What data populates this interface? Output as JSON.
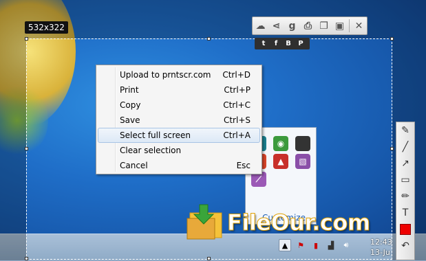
{
  "selection": {
    "size_label": "532x322"
  },
  "toolbar": {
    "buttons": [
      {
        "name": "upload-cloud-icon",
        "glyph": "☁"
      },
      {
        "name": "share-icon",
        "glyph": "⋖"
      },
      {
        "name": "google-icon",
        "glyph": "g"
      },
      {
        "name": "print-icon",
        "glyph": "⎙"
      },
      {
        "name": "copy-icon",
        "glyph": "❐"
      },
      {
        "name": "save-icon",
        "glyph": "▣"
      },
      {
        "name": "close-icon",
        "glyph": "✕"
      }
    ]
  },
  "social": [
    "t",
    "f",
    "B",
    "P"
  ],
  "context_menu": {
    "items": [
      {
        "label": "Upload to prntscr.com",
        "shortcut": "Ctrl+D"
      },
      {
        "label": "Print",
        "shortcut": "Ctrl+P"
      },
      {
        "label": "Copy",
        "shortcut": "Ctrl+C"
      },
      {
        "label": "Save",
        "shortcut": "Ctrl+S"
      },
      {
        "label": "Select full screen",
        "shortcut": "Ctrl+A"
      },
      {
        "label": "Clear selection",
        "shortcut": ""
      },
      {
        "label": "Cancel",
        "shortcut": "Esc"
      }
    ],
    "highlighted_index": 4
  },
  "side_tools": [
    {
      "name": "pen-icon",
      "glyph": "✎"
    },
    {
      "name": "line-icon",
      "glyph": "╱"
    },
    {
      "name": "arrow-icon",
      "glyph": "↗"
    },
    {
      "name": "rectangle-icon",
      "glyph": "▭"
    },
    {
      "name": "marker-icon",
      "glyph": "✏"
    },
    {
      "name": "text-icon",
      "glyph": "T"
    },
    {
      "name": "color-swatch-icon",
      "glyph": ""
    },
    {
      "name": "undo-icon",
      "glyph": "↶"
    }
  ],
  "tray_popup": {
    "customize_label": "Customize...",
    "icons": [
      {
        "name": "tray-app-icon-1",
        "glyph": "e",
        "color": "#1b7f8f"
      },
      {
        "name": "tray-app-icon-2",
        "glyph": "◉",
        "color": "#3c9a3c"
      },
      {
        "name": "tray-app-icon-3",
        "glyph": "",
        "color": "#333333"
      },
      {
        "name": "tray-ccleaner-icon",
        "glyph": "C",
        "color": "#d8452a"
      },
      {
        "name": "tray-app-icon-5",
        "glyph": "▲",
        "color": "#c8302a"
      },
      {
        "name": "tray-app-icon-6",
        "glyph": "▧",
        "color": "#8a4fa8"
      },
      {
        "name": "tray-feather-icon",
        "glyph": "⟋",
        "color": "#9b59b6"
      }
    ]
  },
  "clock": {
    "time": "12:43",
    "date": "13-Ju"
  },
  "watermark": {
    "text": "FileOur.com"
  },
  "colors": {
    "accent_red": "#ee0000"
  }
}
